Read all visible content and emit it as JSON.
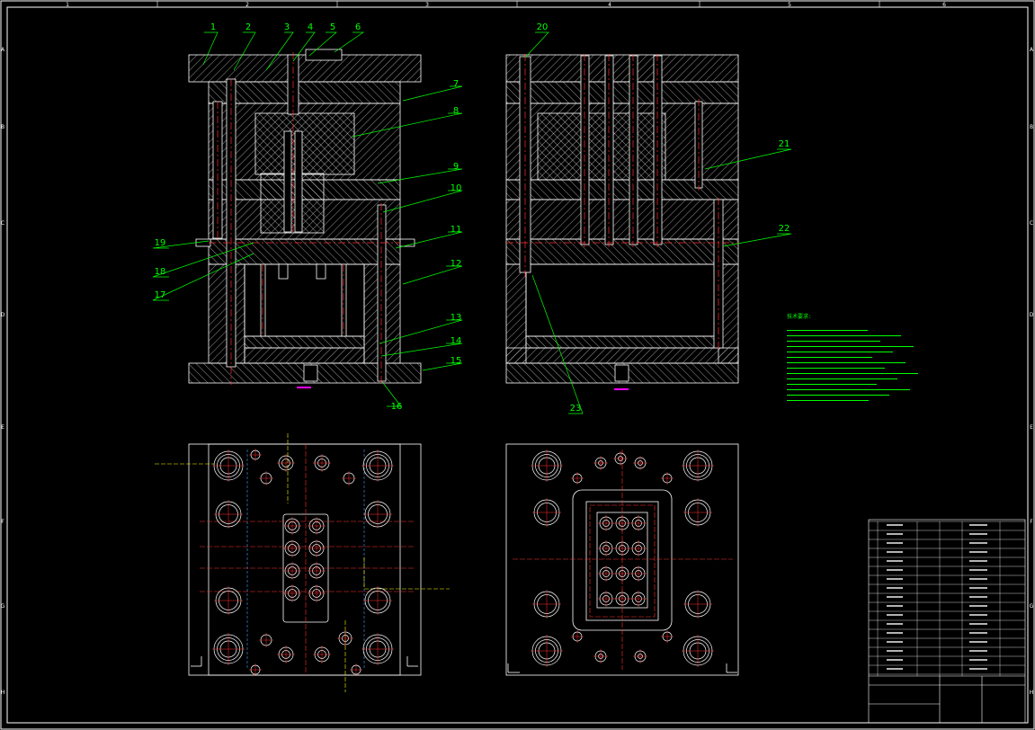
{
  "drawing": {
    "border_columns": [
      "1",
      "2",
      "3",
      "4",
      "5",
      "6"
    ],
    "border_rows": [
      "A",
      "B",
      "C",
      "D",
      "E",
      "F",
      "G",
      "H"
    ],
    "part_labels_front": [
      "1",
      "2",
      "3",
      "4",
      "5",
      "6",
      "7",
      "8",
      "9",
      "10",
      "11",
      "12",
      "13",
      "14",
      "15",
      "16",
      "17",
      "18",
      "19"
    ],
    "part_labels_side": [
      "20",
      "21",
      "22",
      "23"
    ],
    "notes_heading": "技术要求:",
    "colors": {
      "background": "#000000",
      "outline": "#ffffff",
      "leader": "#00ff00",
      "centerline": "#ff3030",
      "dimension": "#ffff00",
      "annotation": "#ff00ff",
      "gate": "#ffd000"
    }
  }
}
